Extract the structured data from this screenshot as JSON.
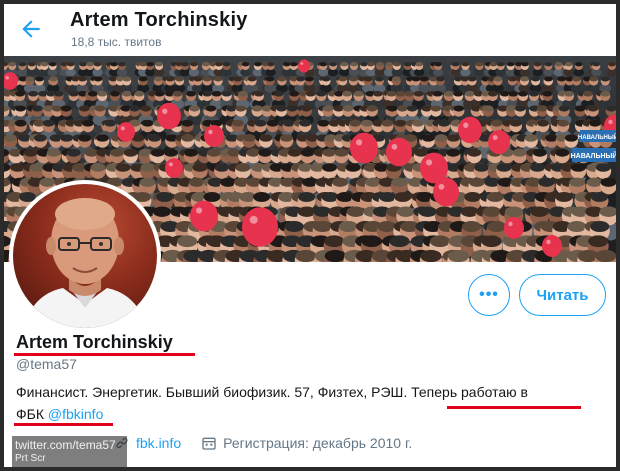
{
  "header": {
    "name": "Artem Torchinskiy",
    "tweet_count": "18,8 тыс. твитов",
    "back_icon": "arrow-left-icon"
  },
  "banner": {
    "description_colors": {
      "balloon": "#e8334f",
      "sign": "#2a6fb4"
    },
    "sign_texts": [
      "НАВАЛЬНЫЙ",
      "НАВАЛЬНЫЙ"
    ]
  },
  "actions": {
    "more_label": "•••",
    "follow_label": "Читать"
  },
  "profile": {
    "name": "Artem Torchinskiy",
    "handle": "@tema57",
    "bio_line1": "Финансист. Энергетик. Бывший биофизик.  57, Физтех, РЭШ. Теперь работаю в",
    "bio_line2_prefix": "ФБК ",
    "bio_line2_link": "@fbkinfo",
    "website": "fbk.info",
    "joined": "Регистрация: декабрь 2010 г."
  },
  "watermark": {
    "line1": "twitter.com/tema57",
    "line2": "Prt Scr"
  },
  "colors": {
    "accent": "#1da1f2",
    "underline": "#e0001b",
    "text": "#14171a",
    "muted": "#657786"
  }
}
